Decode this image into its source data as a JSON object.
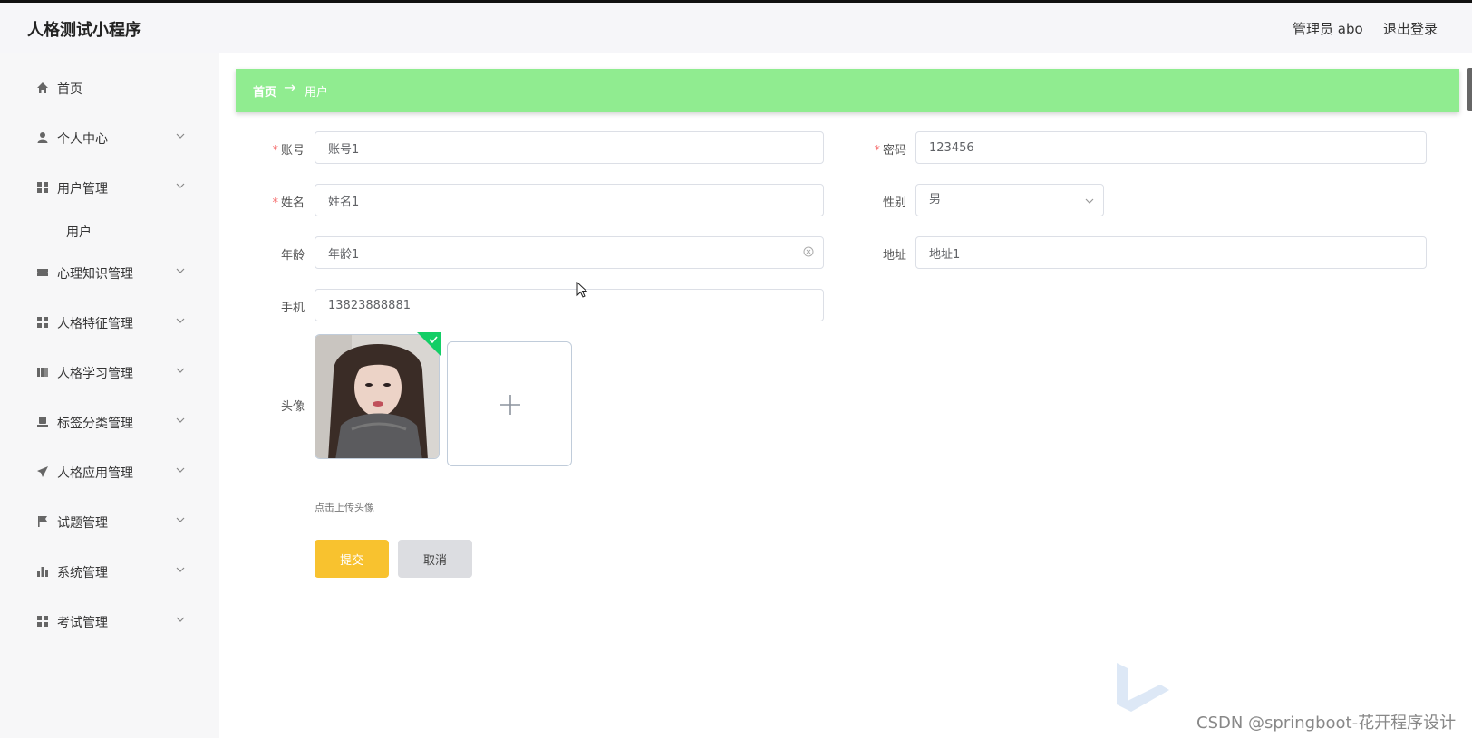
{
  "header": {
    "app_title": "人格测试小程序",
    "user_label": "管理员 abo",
    "logout_label": "退出登录"
  },
  "sidebar": {
    "items": [
      {
        "label": "首页",
        "icon": "home-icon"
      },
      {
        "label": "个人中心",
        "icon": "user-icon"
      },
      {
        "label": "用户管理",
        "icon": "grid-icon"
      },
      {
        "label": "用户",
        "icon": ""
      },
      {
        "label": "心理知识管理",
        "icon": "ticket-icon"
      },
      {
        "label": "人格特征管理",
        "icon": "grid-icon"
      },
      {
        "label": "人格学习管理",
        "icon": "book-icon"
      },
      {
        "label": "标签分类管理",
        "icon": "stamp-icon"
      },
      {
        "label": "人格应用管理",
        "icon": "send-icon"
      },
      {
        "label": "试题管理",
        "icon": "flag-icon"
      },
      {
        "label": "系统管理",
        "icon": "bar-chart-icon"
      },
      {
        "label": "考试管理",
        "icon": "grid-icon"
      }
    ]
  },
  "breadcrumb": {
    "home": "首页",
    "arrow": "→",
    "current": "用户"
  },
  "form": {
    "account": {
      "label": "账号",
      "value": "账号1"
    },
    "password": {
      "label": "密码",
      "value": "123456"
    },
    "name": {
      "label": "姓名",
      "value": "姓名1"
    },
    "gender": {
      "label": "性别",
      "value": "男"
    },
    "age": {
      "label": "年龄",
      "value": "年龄1"
    },
    "address": {
      "label": "地址",
      "value": "地址1"
    },
    "phone": {
      "label": "手机",
      "value": "13823888881"
    },
    "avatar": {
      "label": "头像",
      "tip": "点击上传头像"
    },
    "submit_label": "提交",
    "cancel_label": "取消"
  },
  "colors": {
    "breadcrumb_bg": "#90ec90",
    "submit_bg": "#f8c22f",
    "cancel_bg": "#dcdde1",
    "required": "#f56c6c",
    "success_badge": "#13ce66"
  },
  "watermark": "CSDN @springboot-花开程序设计"
}
